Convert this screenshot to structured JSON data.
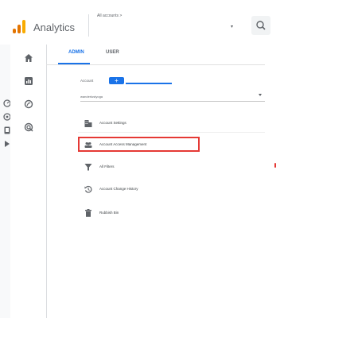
{
  "header": {
    "app_title": "Analytics",
    "breadcrumb": "All accounts >",
    "search_icon": "search-icon",
    "logo_colors": [
      "#f9ab00",
      "#e37400",
      "#e37400"
    ]
  },
  "rail": {
    "icons": [
      "clock-icon",
      "flag-icon",
      "device-icon",
      "arrow-right-icon"
    ]
  },
  "nav": {
    "items": [
      {
        "icon": "home-icon"
      },
      {
        "icon": "reports-icon"
      },
      {
        "icon": "explore-icon"
      },
      {
        "icon": "advertising-icon"
      }
    ]
  },
  "tabs": [
    {
      "label": "ADMIN",
      "active": true
    },
    {
      "label": "USER",
      "active": false
    }
  ],
  "account": {
    "label": "Account",
    "create_label": "+",
    "selected": "wanderlustyoga"
  },
  "menu": [
    {
      "label": "Account Settings",
      "icon": "building-icon"
    },
    {
      "label": "Account Access Management",
      "icon": "people-icon",
      "highlighted": true
    },
    {
      "label": "All Filters",
      "icon": "filter-icon"
    },
    {
      "label": "Account Change History",
      "icon": "history-icon"
    },
    {
      "label": "Rubbish Bin",
      "icon": "trash-icon"
    }
  ],
  "colors": {
    "accent": "#1a73e8",
    "highlight_border": "#e53935"
  }
}
